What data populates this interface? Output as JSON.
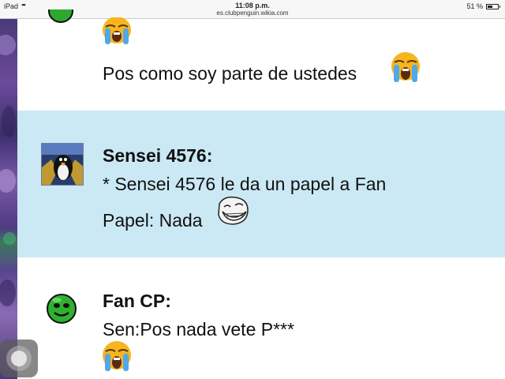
{
  "status_bar": {
    "device": "iPad",
    "time": "11:08 p.m.",
    "url": "es.clubpenguin.wikia.com",
    "battery_label": "51 %",
    "battery_level": 0.51
  },
  "messages": [
    {
      "author": "",
      "lines": [
        "Pos como soy parte de ustedes"
      ],
      "emoji": [
        "loudly-crying-face",
        "loudly-crying-face"
      ]
    },
    {
      "author": "Sensei 4576:",
      "lines": [
        "* Sensei 4576 le da un papel a Fan",
        "Papel: Nada"
      ],
      "emoji": [
        "troll-face"
      ],
      "background": "#cbe9f4"
    },
    {
      "author": "Fan CP:",
      "lines": [
        "Sen:Pos nada vete P***"
      ],
      "emoji": [
        "loudly-crying-face"
      ]
    }
  ],
  "colors": {
    "highlight_row": "#cbe9f4",
    "text": "#111111",
    "side_strip": "#5a4590"
  }
}
